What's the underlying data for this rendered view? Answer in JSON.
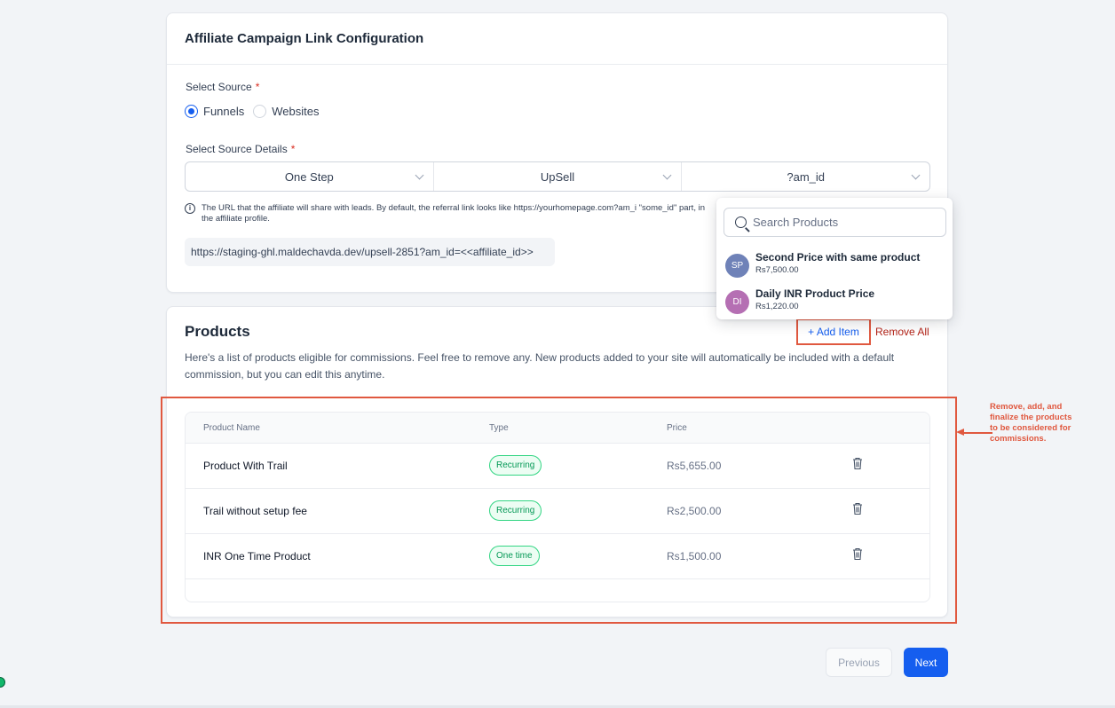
{
  "config": {
    "title": "Affiliate Campaign Link Configuration",
    "source_label": "Select Source",
    "source_options": [
      "Funnels",
      "Websites"
    ],
    "selected_source": "Funnels",
    "details_label": "Select Source Details",
    "details_selects": [
      "One Step",
      "UpSell",
      "?am_id"
    ],
    "info_text": "The URL that the affiliate will share with leads. By default, the referral link looks like https://yourhomepage.com?am_i \"some_id\" part, in the affiliate profile.",
    "url": "https://staging-ghl.maldechavda.dev/upsell-2851?am_id=<<affiliate_id>>"
  },
  "products": {
    "title": "Products",
    "add_item_label": "+ Add Item",
    "remove_all_label": "Remove All",
    "description": "Here's a list of products eligible for commissions. Feel free to remove any. New products added to your site will automatically be included with a default commission, but you can edit this anytime.",
    "columns": [
      "Product Name",
      "Type",
      "Price"
    ],
    "rows": [
      {
        "name": "Product With Trail",
        "type": "Recurring",
        "price": "Rs5,655.00"
      },
      {
        "name": "Trail without setup fee",
        "type": "Recurring",
        "price": "Rs2,500.00"
      },
      {
        "name": "INR One Time Product",
        "type": "One time",
        "price": "Rs1,500.00"
      }
    ]
  },
  "dropdown": {
    "search_placeholder": "Search Products",
    "items": [
      {
        "initials": "SP",
        "name": "Second Price with same product",
        "price": "Rs7,500.00",
        "color": "#6f82b8"
      },
      {
        "initials": "DI",
        "name": "Daily INR Product Price",
        "price": "Rs1,220.00",
        "color": "#b56fb3"
      }
    ]
  },
  "annotation": {
    "text": "Remove, add, and finalize the products to be considered for commissions.",
    "color": "#e0583f"
  },
  "footer": {
    "previous_label": "Previous",
    "next_label": "Next"
  },
  "colors": {
    "primary": "#155eef",
    "danger": "#b42318",
    "success": "#039855"
  }
}
